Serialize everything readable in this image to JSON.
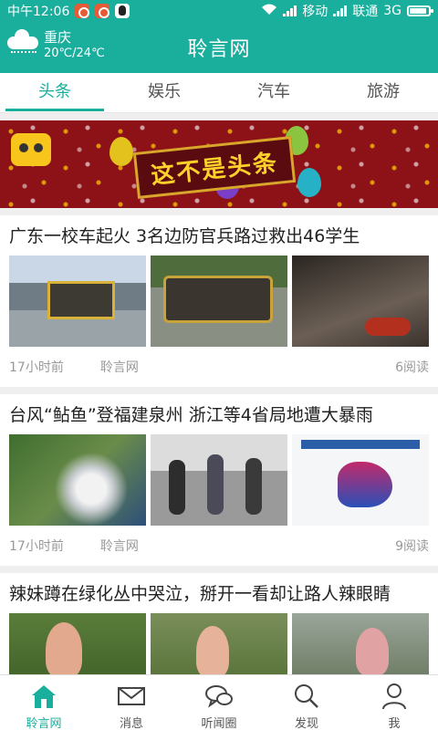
{
  "status_bar": {
    "time": "中午12:06",
    "carrier1": "移动",
    "carrier2": "联通",
    "network": "3G",
    "battery_level": 0.9
  },
  "header": {
    "title": "聆言网",
    "weather": {
      "city": "重庆",
      "temp": "20℃/24℃"
    }
  },
  "tabs": [
    {
      "label": "头条",
      "active": true
    },
    {
      "label": "娱乐",
      "active": false
    },
    {
      "label": "汽车",
      "active": false
    },
    {
      "label": "旅游",
      "active": false
    }
  ],
  "banner": {
    "text": "这不是头条"
  },
  "articles": [
    {
      "title": "广东一校车起火 3名边防官兵路过救出46学生",
      "time": "17小时前",
      "source": "聆言网",
      "reads": "6阅读"
    },
    {
      "title": "台风“鲇鱼”登福建泉州 浙江等4省局地遭大暴雨",
      "time": "17小时前",
      "source": "聆言网",
      "reads": "9阅读"
    },
    {
      "title": "辣妹蹲在绿化丛中哭泣，掰开一看却让路人辣眼睛"
    }
  ],
  "bottom_nav": [
    {
      "label": "聆言网",
      "icon": "home-icon",
      "active": true
    },
    {
      "label": "消息",
      "icon": "mail-icon",
      "active": false
    },
    {
      "label": "听闻圈",
      "icon": "chat-bubbles-icon",
      "active": false
    },
    {
      "label": "发现",
      "icon": "search-icon",
      "active": false
    },
    {
      "label": "我",
      "icon": "person-icon",
      "active": false
    }
  ],
  "colors": {
    "accent": "#1aae9c",
    "banner_bg": "#8c1218"
  }
}
